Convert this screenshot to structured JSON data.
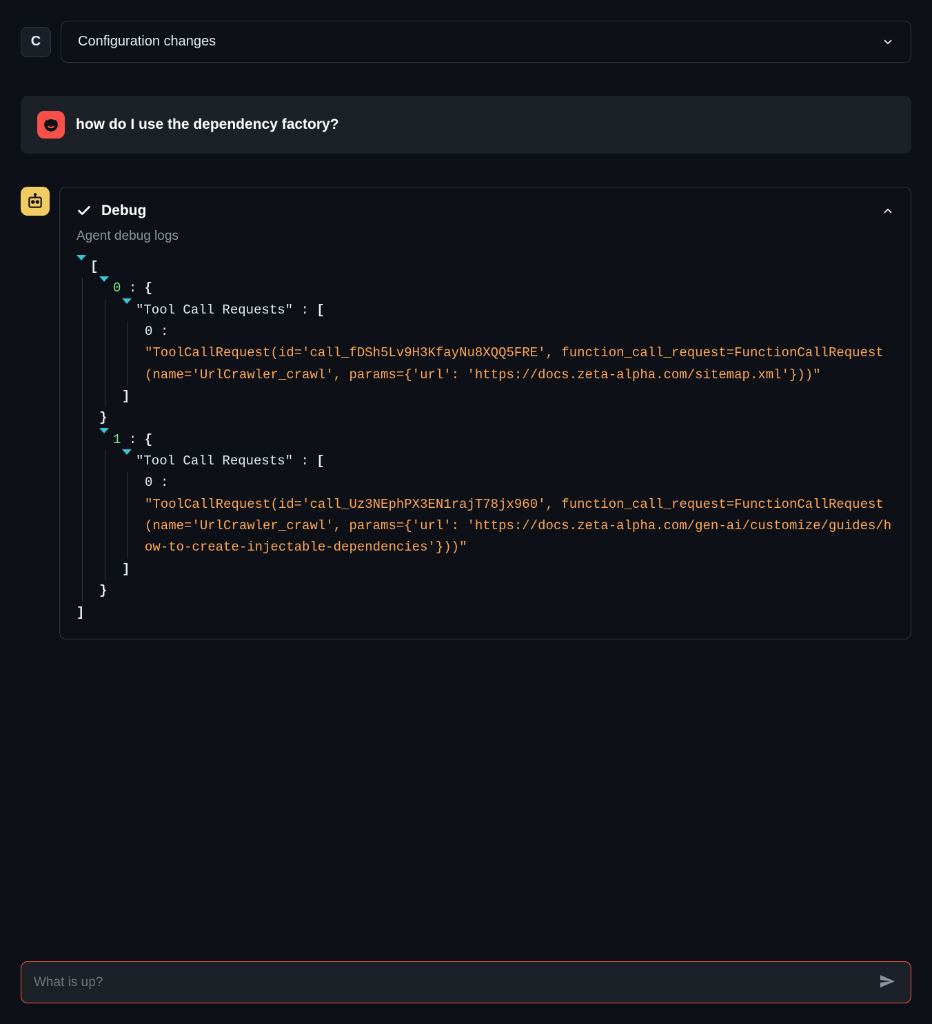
{
  "header": {
    "avatar_letter": "C",
    "dropdown_label": "Configuration changes"
  },
  "user_message": {
    "text": "how do I use the dependency factory?"
  },
  "debug": {
    "title": "Debug",
    "subtitle": "Agent debug logs",
    "entries": [
      {
        "index": "0",
        "key": "\"Tool Call Requests\"",
        "item_index": "0",
        "value": "\"ToolCallRequest(id='call_fDSh5Lv9H3KfayNu8XQQ5FRE', function_call_request=FunctionCallRequest(name='UrlCrawler_crawl', params={'url': 'https://docs.zeta-alpha.com/sitemap.xml'}))\""
      },
      {
        "index": "1",
        "key": "\"Tool Call Requests\"",
        "item_index": "0",
        "value": "\"ToolCallRequest(id='call_Uz3NEphPX3EN1rajT78jx960', function_call_request=FunctionCallRequest(name='UrlCrawler_crawl', params={'url': 'https://docs.zeta-alpha.com/gen-ai/customize/guides/how-to-create-injectable-dependencies'}))\""
      }
    ]
  },
  "input": {
    "placeholder": "What is up?"
  },
  "glyphs": {
    "open_bracket": "[",
    "close_bracket": "]",
    "open_brace": "{",
    "close_brace": "}",
    "colon": ":"
  }
}
